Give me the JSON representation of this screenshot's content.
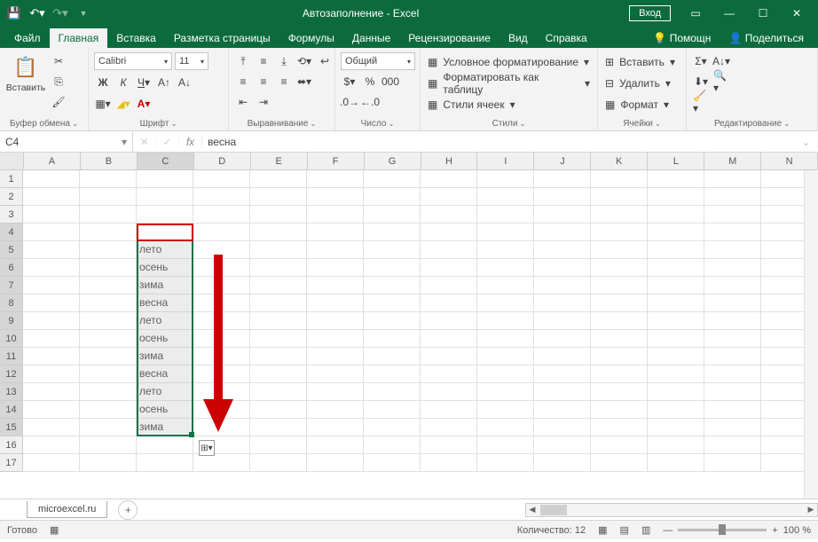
{
  "titlebar": {
    "title": "Автозаполнение  -  Excel",
    "login": "Вход"
  },
  "tabs": {
    "file": "Файл",
    "home": "Главная",
    "insert": "Вставка",
    "layout": "Разметка страницы",
    "formulas": "Формулы",
    "data": "Данные",
    "review": "Рецензирование",
    "view": "Вид",
    "help": "Справка",
    "assist": "Помощн",
    "share": "Поделиться"
  },
  "ribbon": {
    "clipboard": {
      "label": "Буфер обмена",
      "paste": "Вставить"
    },
    "font": {
      "label": "Шрифт",
      "name": "Calibri",
      "size": "11"
    },
    "alignment": {
      "label": "Выравнивание"
    },
    "number": {
      "label": "Число",
      "format": "Общий"
    },
    "styles": {
      "label": "Стили",
      "cond": "Условное форматирование",
      "table": "Форматировать как таблицу",
      "cell": "Стили ячеек"
    },
    "cells": {
      "label": "Ячейки",
      "insert": "Вставить",
      "delete": "Удалить",
      "format": "Формат"
    },
    "editing": {
      "label": "Редактирование"
    }
  },
  "namebox": "C4",
  "formula": "весна",
  "columns": [
    "A",
    "B",
    "C",
    "D",
    "E",
    "F",
    "G",
    "H",
    "I",
    "J",
    "K",
    "L",
    "M",
    "N"
  ],
  "rows": [
    1,
    2,
    3,
    4,
    5,
    6,
    7,
    8,
    9,
    10,
    11,
    12,
    13,
    14,
    15,
    16,
    17
  ],
  "cells": {
    "C4": "весна",
    "C5": "лето",
    "C6": "осень",
    "C7": "зима",
    "C8": "весна",
    "C9": "лето",
    "C10": "осень",
    "C11": "зима",
    "C12": "весна",
    "C13": "лето",
    "C14": "осень",
    "C15": "зима"
  },
  "sheet": "microexcel.ru",
  "status": {
    "ready": "Готово",
    "count_label": "Количество:",
    "count": "12",
    "zoom": "100 %"
  },
  "colors": {
    "excel_green": "#0c6b3d",
    "selection": "#127347",
    "active_border": "#c00"
  }
}
